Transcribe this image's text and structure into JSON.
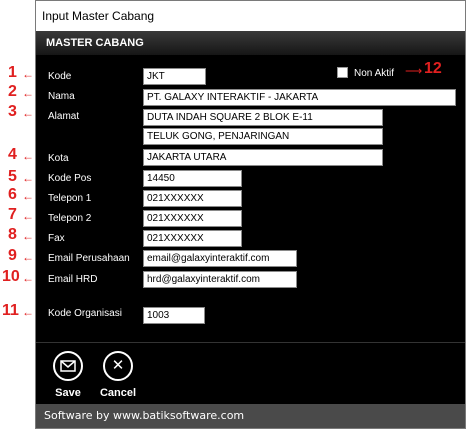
{
  "window": {
    "title": "Input Master Cabang"
  },
  "header": {
    "title": "MASTER CABANG"
  },
  "form": {
    "kode_label": "Kode",
    "kode_value": "JKT",
    "nama_label": "Nama",
    "nama_value": "PT. GALAXY INTERAKTIF - JAKARTA",
    "alamat_label": "Alamat",
    "alamat_line1": "DUTA INDAH SQUARE 2 BLOK E-11",
    "alamat_line2": "TELUK GONG, PENJARINGAN",
    "kota_label": "Kota",
    "kota_value": "JAKARTA UTARA",
    "kodepos_label": "Kode Pos",
    "kodepos_value": "14450",
    "telepon1_label": "Telepon 1",
    "telepon1_value": "021XXXXXX",
    "telepon2_label": "Telepon 2",
    "telepon2_value": "021XXXXXX",
    "fax_label": "Fax",
    "fax_value": "021XXXXXX",
    "email_perusahaan_label": "Email Perusahaan",
    "email_perusahaan_value": "email@galaxyinteraktif.com",
    "email_hrd_label": "Email HRD",
    "email_hrd_value": "hrd@galaxyinteraktif.com",
    "kode_organisasi_label": "Kode Organisasi",
    "kode_organisasi_value": "1003",
    "non_aktif_label": "Non Aktif",
    "non_aktif_checked": false
  },
  "buttons": {
    "save": "Save",
    "cancel": "Cancel"
  },
  "footer": {
    "text": "Software by www.batiksoftware.com"
  },
  "annotations": [
    "1",
    "2",
    "3",
    "4",
    "5",
    "6",
    "7",
    "8",
    "9",
    "10",
    "11",
    "12"
  ],
  "colors": {
    "annotation": "#e02020",
    "panel": "#000000"
  },
  "icons": {
    "save": "envelope-icon",
    "cancel": "close-icon"
  }
}
